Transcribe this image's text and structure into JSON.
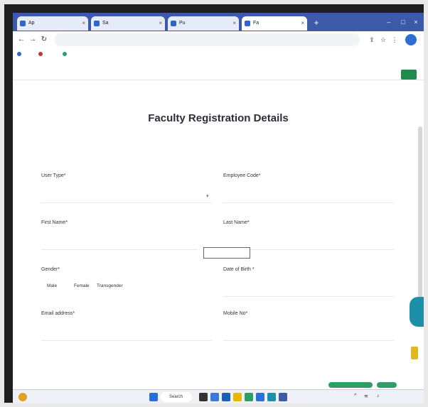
{
  "browser": {
    "tabs": [
      {
        "label": "Ap"
      },
      {
        "label": "Sa"
      },
      {
        "label": "Pu"
      },
      {
        "label": "Fa"
      }
    ],
    "address": "",
    "bookmarks": [
      {
        "label": "",
        "color": "#2f66c9"
      },
      {
        "label": "",
        "color": "#c0392b"
      },
      {
        "label": "",
        "color": "#2e9e66"
      }
    ]
  },
  "appnav": {
    "links": [
      "",
      "",
      "",
      ""
    ]
  },
  "page": {
    "title": "Faculty Registration Details",
    "subtitle": "",
    "fields": {
      "user_type": {
        "label": "User Type*",
        "value": ""
      },
      "employee_code": {
        "label": "Employee Code*",
        "value": ""
      },
      "first_name": {
        "label": "First Name*",
        "value": ""
      },
      "last_name": {
        "label": "Last Name*",
        "value": ""
      },
      "gender": {
        "label": "Gender*",
        "options": [
          "Male",
          "Female",
          "Transgender"
        ]
      },
      "dob": {
        "label": "Date of Birth *",
        "value": ""
      },
      "email": {
        "label": "Email address*",
        "value": ""
      },
      "mobile": {
        "label": "Mobile No*",
        "value": ""
      }
    },
    "tooltip": ""
  },
  "taskbar": {
    "search_label": "Search",
    "time": "",
    "date": ""
  },
  "colors": {
    "tabstrip": "#3c5aa8",
    "accent_green": "#1f8a4c",
    "fab_teal": "#1e8fa8"
  }
}
